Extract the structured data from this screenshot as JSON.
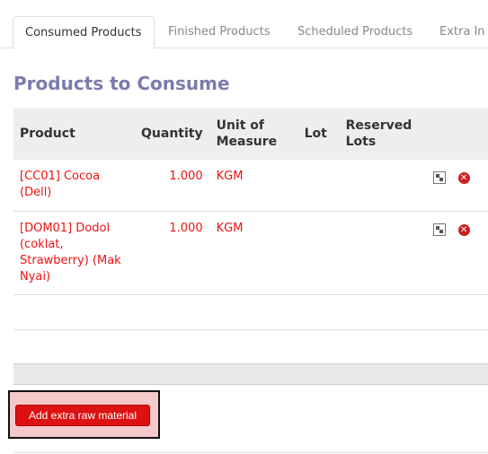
{
  "tabs": [
    {
      "label": "Consumed Products",
      "active": true
    },
    {
      "label": "Finished Products",
      "active": false
    },
    {
      "label": "Scheduled Products",
      "active": false
    },
    {
      "label": "Extra In",
      "active": false
    }
  ],
  "section_title": "Products to Consume",
  "table": {
    "headers": {
      "product": "Product",
      "quantity": "Quantity",
      "uom": "Unit of Measure",
      "lot": "Lot",
      "reserved": "Reserved Lots"
    },
    "rows": [
      {
        "product": "[CC01] Cocoa (Dell)",
        "quantity": "1.000",
        "uom": "KGM",
        "lot": "",
        "reserved": ""
      },
      {
        "product": "[DOM01] Dodol (coklat, Strawberry) (Mak Nyai)",
        "quantity": "1.000",
        "uom": "KGM",
        "lot": "",
        "reserved": ""
      }
    ]
  },
  "actions": {
    "split_icon": "split-icon",
    "delete_icon": "delete-icon",
    "delete_glyph": "✕"
  },
  "add_button_label": "Add extra raw material",
  "colors": {
    "title": "#7c7bad",
    "link": "#ee1111",
    "button": "#dd1111",
    "highlight": "#f5c9c9"
  }
}
